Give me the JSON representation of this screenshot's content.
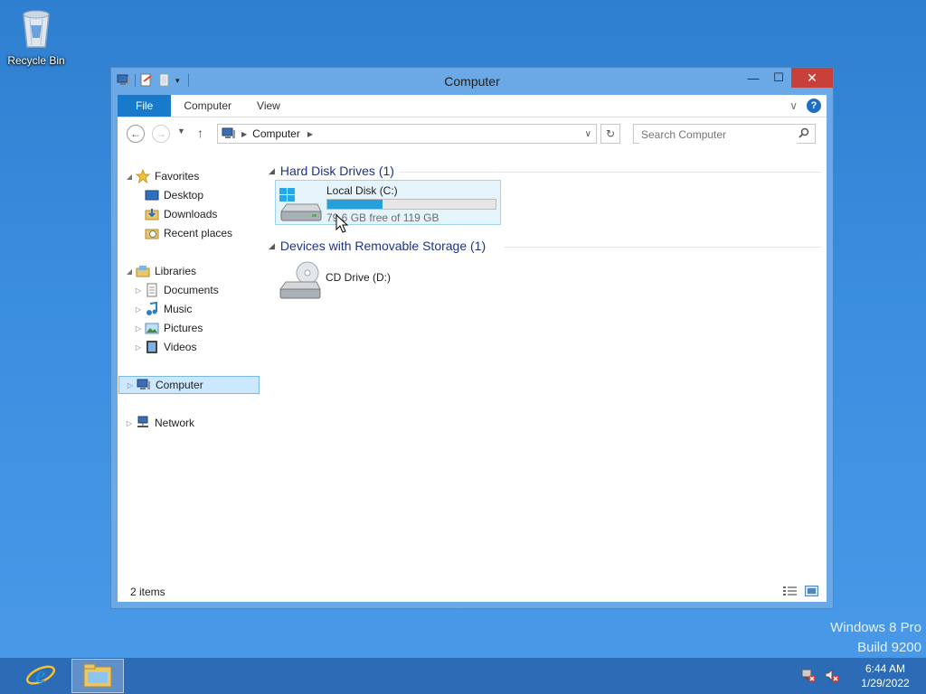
{
  "desktop": {
    "recycle_bin_label": "Recycle Bin"
  },
  "window": {
    "title": "Computer",
    "minimize_glyph": "—",
    "maximize_glyph": "☐",
    "close_glyph": "✕"
  },
  "ribbon": {
    "tabs": [
      {
        "label": "File"
      },
      {
        "label": "Computer"
      },
      {
        "label": "View"
      }
    ],
    "expand_glyph": "∨",
    "help_glyph": "?"
  },
  "address": {
    "crumb": "Computer",
    "search_placeholder": "Search Computer"
  },
  "nav": {
    "favorites": "Favorites",
    "desktop": "Desktop",
    "downloads": "Downloads",
    "recent": "Recent places",
    "libraries": "Libraries",
    "documents": "Documents",
    "music": "Music",
    "pictures": "Pictures",
    "videos": "Videos",
    "computer": "Computer",
    "network": "Network"
  },
  "content": {
    "group_hdd": "Hard Disk Drives (1)",
    "group_removable": "Devices with Removable Storage (1)",
    "drive_c": {
      "name": "Local Disk (C:)",
      "free_text": "79.6 GB free of 119 GB",
      "used_fraction": 0.33
    },
    "drive_d": {
      "name": "CD Drive (D:)"
    }
  },
  "status": {
    "items": "2 items"
  },
  "watermark": {
    "line1": "Windows 8 Pro",
    "line2": "Build 9200"
  },
  "taskbar": {
    "time": "6:44 AM",
    "date": "1/29/2022"
  },
  "colors": {
    "accent": "#1979ca",
    "close": "#c7413a",
    "bar_fill": "#26a0da"
  }
}
